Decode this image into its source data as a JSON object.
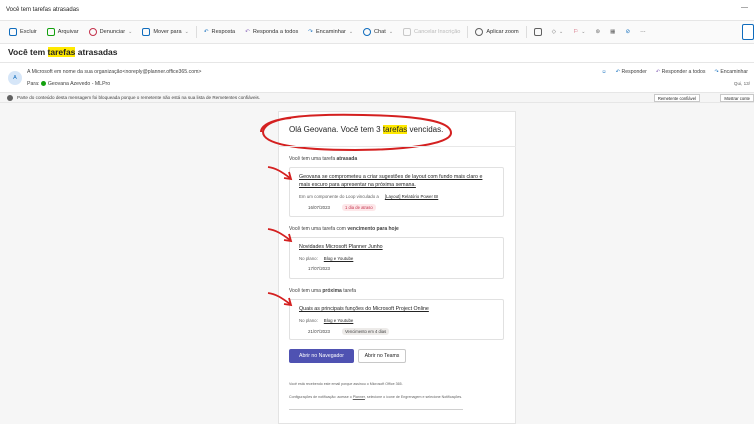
{
  "window": {
    "title": "Você tem tarefas atrasadas",
    "min": "—"
  },
  "toolbar": [
    {
      "label": "Excluir",
      "icon": "trash-icon"
    },
    {
      "label": "Arquivar",
      "icon": "archive-icon"
    },
    {
      "label": "Denunciar",
      "icon": "report-icon"
    },
    {
      "label": "Mover para",
      "icon": "move-icon"
    },
    {
      "label": "Resposta",
      "icon": "reply-icon"
    },
    {
      "label": "Responda a todos",
      "icon": "reply-all-icon"
    },
    {
      "label": "Encaminhar",
      "icon": "forward-icon"
    },
    {
      "label": "Chat",
      "icon": "chat-icon"
    },
    {
      "label": "Cancelar Inscrição",
      "icon": "unsubscribe-icon",
      "disabled": true
    },
    {
      "label": "Aplicar zoom",
      "icon": "zoom-icon"
    }
  ],
  "subject": {
    "pre": "Você tem ",
    "highlight": "tarefas",
    "post": " atrasadas"
  },
  "header": {
    "avatar": "A",
    "from": "A Microsoft em nome da sua organização<noreply@planner.office365.com>",
    "to_label": "Para:",
    "to": "Geovana Azevedo - MLPro",
    "reply": "Responder",
    "reply_all": "Responder a todos",
    "forward": "Encaminhar",
    "date": "Qui, 13/"
  },
  "infobar": {
    "text": "Parte do conteúdo desta mensagem foi bloqueada porque o remetente não está na sua lista de Remetentes confiáveis.",
    "trusted": "Remetente confiável",
    "show": "Mostrar conte"
  },
  "email": {
    "greeting_pre": "Olá Geovana. Você tem 3 ",
    "greeting_hl": "tarefas",
    "greeting_post": " vencidas.",
    "sections": [
      {
        "heading_pre": "Você tem uma tarefa ",
        "heading_bold": "atrasada",
        "task_title": "Geovana se comprometeu a criar sugestões de layout com fundo mais claro e mais escuro para apresentar na próxima semana.",
        "meta_label": "Em um componente do Loop vinculado a",
        "meta_link": "[Layout] Relatório Power BI",
        "date": "16/07/2023",
        "badge": "1 dia de atraso"
      },
      {
        "heading_pre": "Você tem uma tarefa com ",
        "heading_bold": "vencimento para hoje",
        "task_title": "Novidades Microsoft Planner Junho",
        "meta_label": "No plano:",
        "meta_link": "Blog e Youtube",
        "date": "17/07/2023",
        "badge": ""
      },
      {
        "heading_pre": "Você tem uma ",
        "heading_bold": "próxima",
        "heading_post": " tarefa",
        "task_title": "Quais as principais funções do Microsoft Project Online",
        "meta_label": "No plano:",
        "meta_link": "Blog e Youtube",
        "date": "21/07/2023",
        "badge": "Vencimento em 4 dias"
      }
    ],
    "btn_browser": "Abrir no Navegador",
    "btn_teams": "Abrir no Teams",
    "footer1": "Você está recebendo este email porque assinou o Microsoft Office 365.",
    "footer2_pre": "Configurações de notificação: acesse o ",
    "footer2_link": "Planner",
    "footer2_post": ", selecione o ícone de Engrenagem e selecione Notificações."
  },
  "colors": {
    "accent": "#0f6cbd",
    "highlight": "#ffe900",
    "annotation": "#d42020",
    "button": "#4f52b2"
  }
}
